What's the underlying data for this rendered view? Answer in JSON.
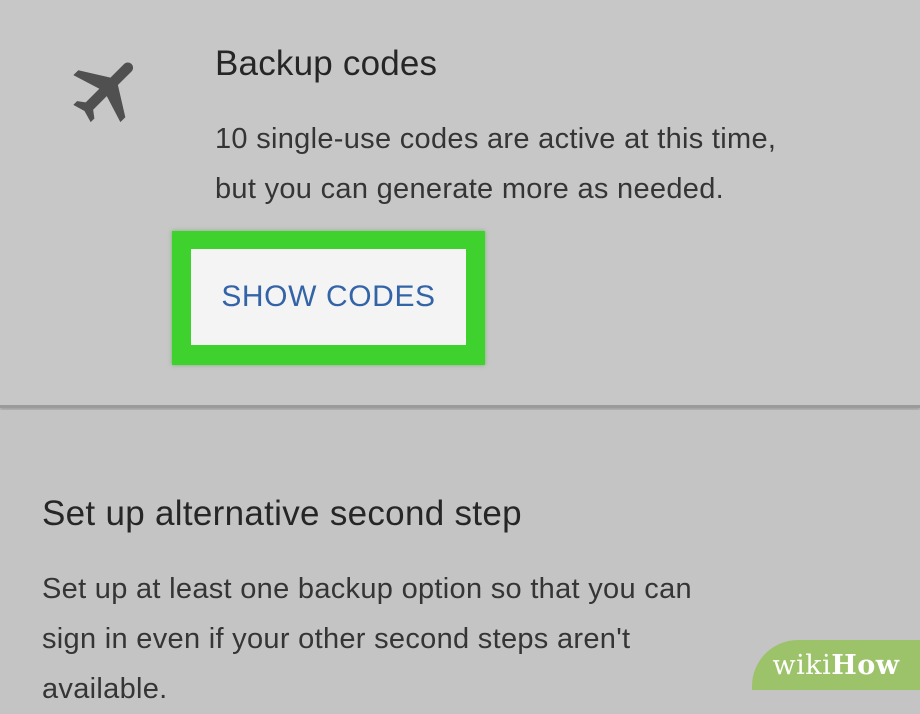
{
  "backup": {
    "icon": "airplane-icon",
    "title": "Backup codes",
    "description_lines": [
      "10 single-use codes are active at this time,",
      "but you can generate more as needed."
    ],
    "button_label": "SHOW CODES",
    "highlight_color": "#3fd12e",
    "button_text_color": "#3464a8"
  },
  "alternative": {
    "title": "Set up alternative second step",
    "description_lines": [
      "Set up at least one backup option so that you can",
      "sign in even if your other second steps aren't",
      "available."
    ]
  },
  "watermark": {
    "wiki": "wiki",
    "how": "How",
    "color": "#9cc36a"
  }
}
